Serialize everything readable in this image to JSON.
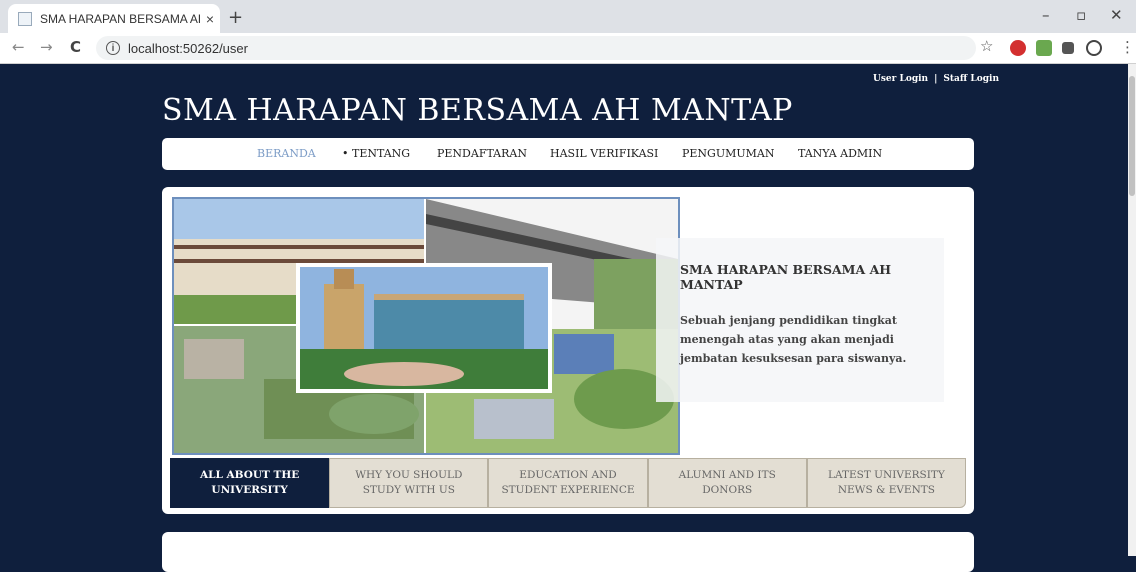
{
  "browser": {
    "tab_title": "SMA HARAPAN BERSAMA AH M",
    "tab_close": "×",
    "new_tab": "+",
    "url": "localhost:50262/user",
    "info_glyph": "i",
    "back": "←",
    "forward": "→",
    "reload": "C",
    "star": "☆",
    "minimize": "–",
    "restore": "▫",
    "close": "✕"
  },
  "header": {
    "user_login": "User Login",
    "separator": "|",
    "staff_login": "Staff Login",
    "site_title": "SMA HARAPAN BERSAMA AH MANTAP"
  },
  "nav": {
    "items": [
      {
        "label": "BERANDA",
        "active": true
      },
      {
        "label": "• TENTANG"
      },
      {
        "label": "PENDAFTARAN"
      },
      {
        "label": "HASIL VERIFIKASI"
      },
      {
        "label": "PENGUMUMAN"
      },
      {
        "label": "TANYA ADMIN"
      }
    ]
  },
  "hero": {
    "title": "SMA HARAPAN BERSAMA AH MANTAP",
    "text": "Sebuah jenjang pendidikan tingkat menengah atas yang akan menjadi jembatan kesuksesan para siswanya."
  },
  "tabs": [
    {
      "label": "ALL ABOUT THE UNIVERSITY",
      "active": true
    },
    {
      "label": "WHY YOU SHOULD STUDY WITH US"
    },
    {
      "label": "EDUCATION AND STUDENT EXPERIENCE"
    },
    {
      "label": "ALUMNI AND ITS DONORS"
    },
    {
      "label": "LATEST UNIVERSITY NEWS & EVENTS"
    }
  ],
  "colors": {
    "page_bg": "#0f1f3d",
    "active_nav": "#7c9cc6",
    "tab_bg": "#e3ded3"
  }
}
